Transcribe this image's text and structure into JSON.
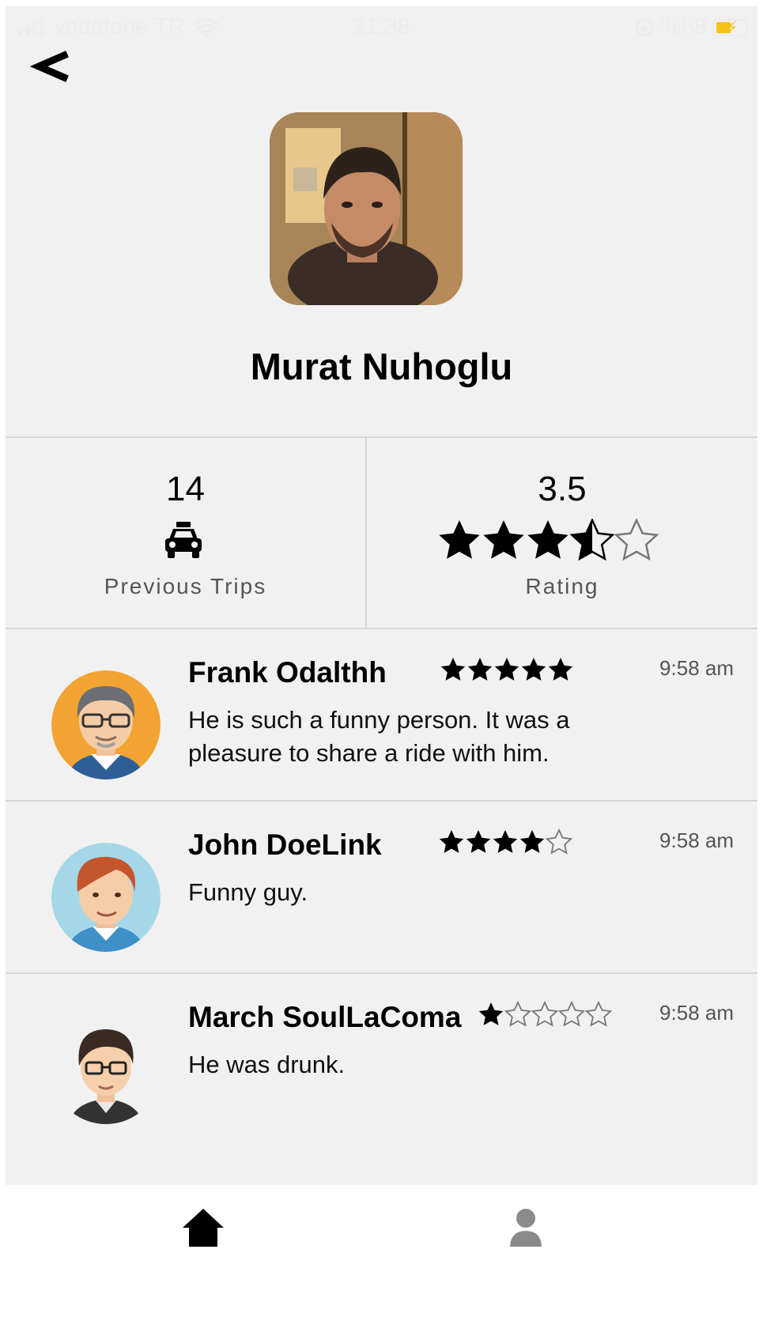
{
  "status_bar": {
    "carrier": "vodafone TR",
    "time": "21:38",
    "battery": "%68"
  },
  "profile": {
    "name": "Murat Nuhoglu"
  },
  "stats": {
    "trips": {
      "value": "14",
      "label": "Previous Trips"
    },
    "rating": {
      "value": "3.5",
      "label": "Rating",
      "stars": 3.5
    }
  },
  "reviews": [
    {
      "name": "Frank Odalthh",
      "stars": 5,
      "time": "9:58 am",
      "text": "He is such a funny person. It was a pleasure to share a ride with him."
    },
    {
      "name": "John DoeLink",
      "stars": 4,
      "time": "9:58 am",
      "text": "Funny guy."
    },
    {
      "name": "March SoulLaComa",
      "stars": 1,
      "time": "9:58 am",
      "text": "He was drunk."
    }
  ],
  "tabs": {
    "home_icon": "home-icon",
    "profile_icon": "person-icon"
  },
  "colors": {
    "background": "#f1f1f1",
    "divider": "#d6d6d6",
    "battery": "#f3c418"
  }
}
